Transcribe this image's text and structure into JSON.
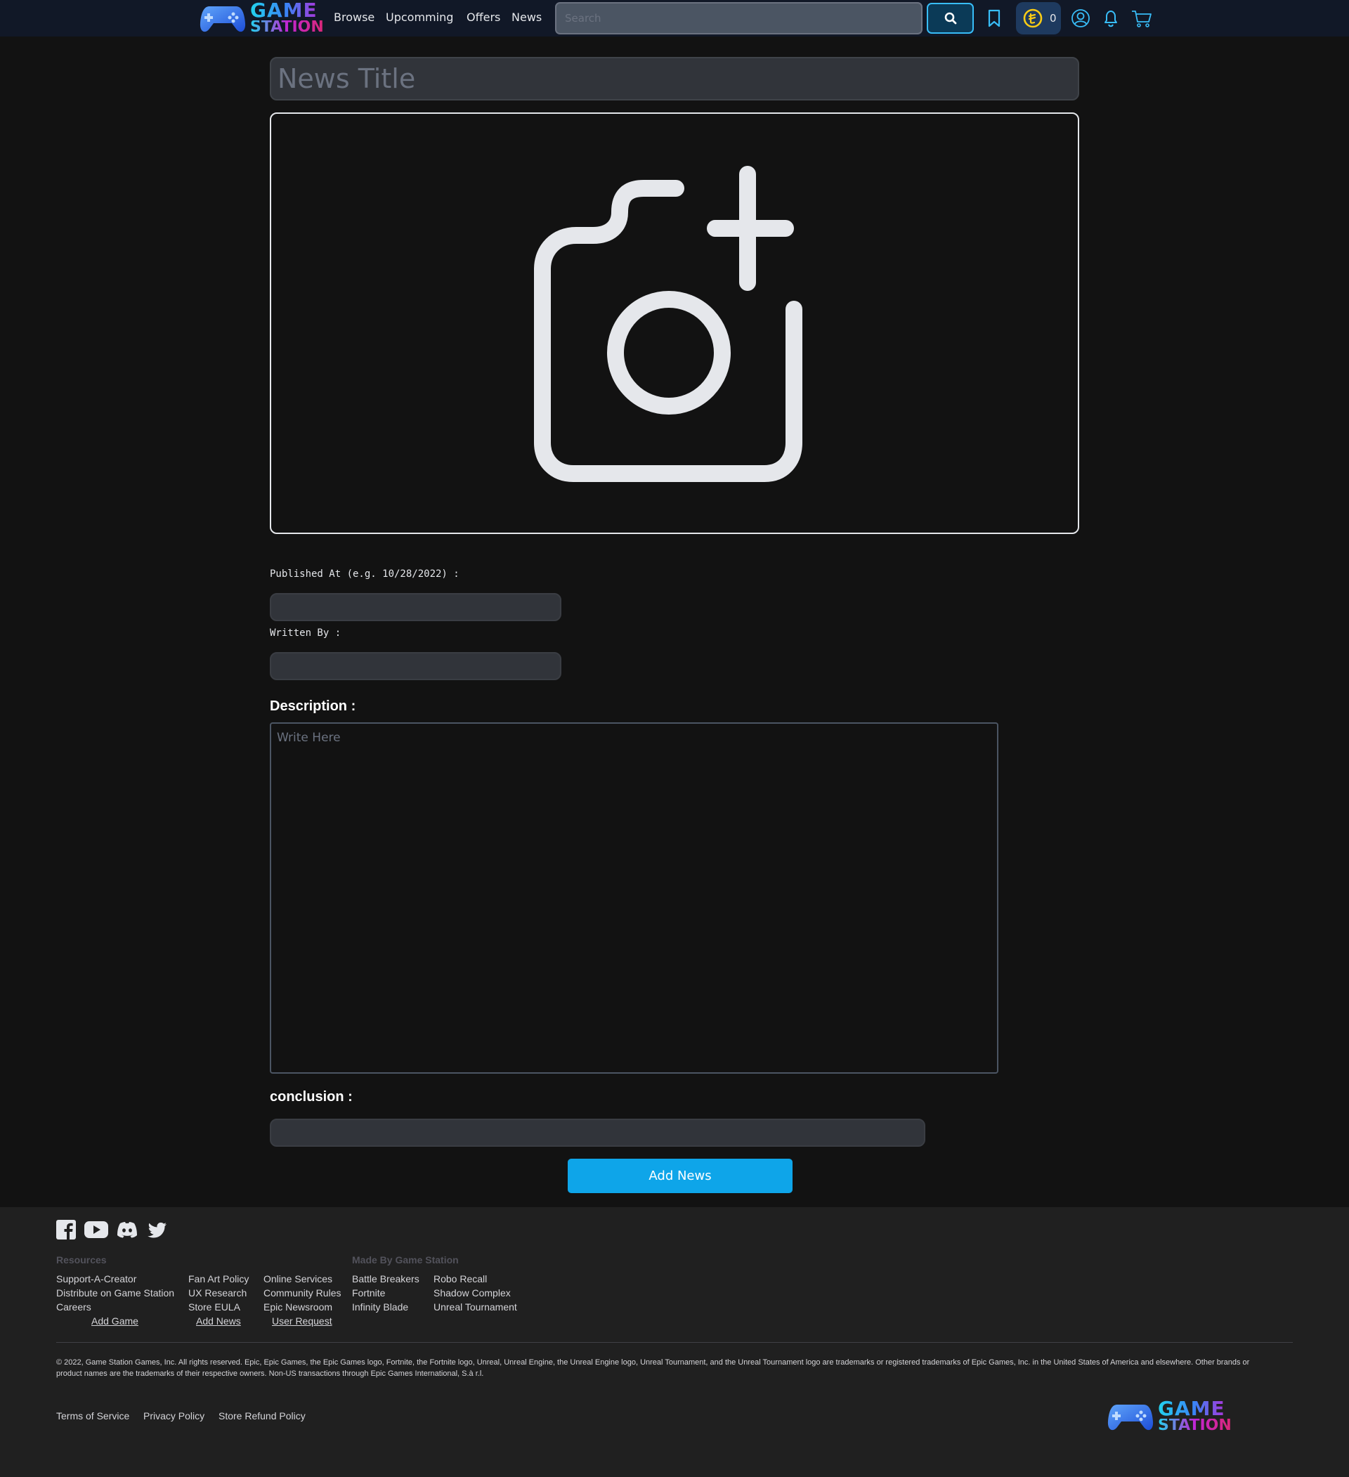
{
  "brand": {
    "line1": "GAME",
    "line2": "STATION"
  },
  "nav": {
    "links": [
      "Browse",
      "Upcomming",
      "Offers",
      "News"
    ],
    "search_placeholder": "Search",
    "coin_count": "0"
  },
  "form": {
    "title_placeholder": "News Title",
    "published_label": "Published At (e.g. 10/28/2022) :",
    "written_label": "Written By :",
    "description_label": "Description :",
    "description_placeholder": "Write Here",
    "conclusion_label": "conclusion :",
    "submit_label": "Add News"
  },
  "footer": {
    "resources_heading": "Resources",
    "made_by_heading": "Made By Game Station",
    "col1": [
      "Support-A-Creator",
      "Distribute on Game Station",
      "Careers"
    ],
    "col1_action": "Add Game",
    "col2": [
      "Fan Art Policy",
      "UX Research",
      "Store EULA"
    ],
    "col2_action": "Add News",
    "col3": [
      "Online Services",
      "Community Rules",
      "Epic Newsroom"
    ],
    "col3_action": "User Request",
    "col4": [
      "Battle Breakers",
      "Fortnite",
      "Infinity Blade"
    ],
    "col5": [
      "Robo Recall",
      "Shadow Complex",
      "Unreal Tournament"
    ],
    "copyright": "© 2022, Game Station Games, Inc. All rights reserved. Epic, Epic Games, the Epic Games logo, Fortnite, the Fortnite logo, Unreal, Unreal Engine, the Unreal Engine logo, Unreal Tournament, and the Unreal Tournament logo are trademarks or registered trademarks of Epic Games, Inc. in the United States of America and elsewhere. Other brands or product names are the trademarks of their respective owners. Non-US transactions through Epic Games International, S.à r.l.",
    "legal": [
      "Terms of Service",
      "Privacy Policy",
      "Store Refund Policy"
    ]
  },
  "colors": {
    "accent": "#0ea5e9",
    "nav_bg": "#111827",
    "footer_bg": "#202020",
    "icon_blue": "#38bdf8"
  }
}
